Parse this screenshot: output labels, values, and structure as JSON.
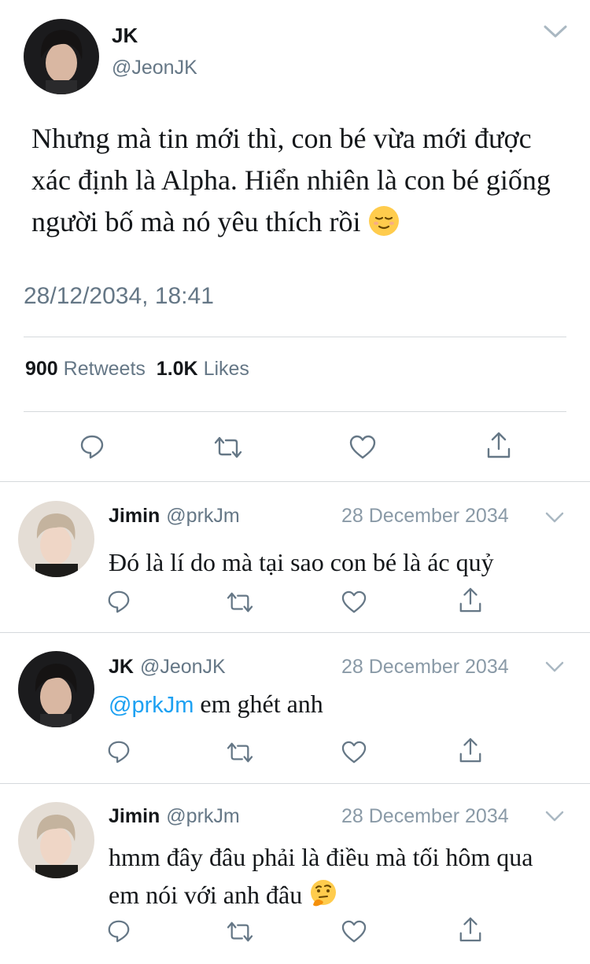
{
  "main_tweet": {
    "author_name": "JK",
    "author_handle": "@JeonJK",
    "text": "Nhưng mà tin mới thì, con bé vừa mới được xác định là Alpha. Hiển nhiên là con bé giống người bố mà nó yêu thích rồi",
    "emoji": "relieved-face-emoji",
    "timestamp": "28/12/2034, 18:41",
    "retweets_count": "900",
    "retweets_label": "Retweets",
    "likes_count": "1.0K",
    "likes_label": "Likes"
  },
  "actions": [
    "reply-icon",
    "retweet-icon",
    "like-icon",
    "share-icon"
  ],
  "replies": [
    {
      "name": "Jimin",
      "handle": "@prkJm",
      "date": "28 December 2034",
      "text": "Đó là lí do mà tại sao con bé là ác quỷ"
    },
    {
      "name": "JK",
      "handle": "@JeonJK",
      "date": "28 December 2034",
      "mention": "@prkJm",
      "text": "em ghét anh"
    },
    {
      "name": "Jimin",
      "handle": "@prkJm",
      "date": "28 December 2034",
      "text": "hmm đây đâu phải là điều mà tối hôm qua em nói với anh đâu",
      "emoji": "thinking-face-emoji"
    }
  ],
  "colors": {
    "text": "#14171a",
    "secondary": "#657786",
    "link": "#1da1f2",
    "divider": "#d5d9dc"
  }
}
